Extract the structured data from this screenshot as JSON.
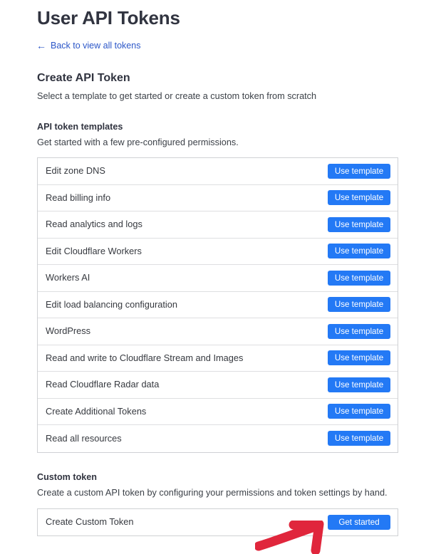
{
  "header": {
    "title": "User API Tokens",
    "back_link": {
      "label": "Back to view all tokens",
      "icon": "arrow-left-icon",
      "glyph": "←"
    }
  },
  "create_section": {
    "heading": "Create API Token",
    "description": "Select a template to get started or create a custom token from scratch"
  },
  "templates_section": {
    "heading": "API token templates",
    "description": "Get started with a few pre-configured permissions.",
    "button_label": "Use template",
    "items": [
      {
        "label": "Edit zone DNS"
      },
      {
        "label": "Read billing info"
      },
      {
        "label": "Read analytics and logs"
      },
      {
        "label": "Edit Cloudflare Workers"
      },
      {
        "label": "Workers AI"
      },
      {
        "label": "Edit load balancing configuration"
      },
      {
        "label": "WordPress"
      },
      {
        "label": "Read and write to Cloudflare Stream and Images"
      },
      {
        "label": "Read Cloudflare Radar data"
      },
      {
        "label": "Create Additional Tokens"
      },
      {
        "label": "Read all resources"
      }
    ]
  },
  "custom_section": {
    "heading": "Custom token",
    "description": "Create a custom API token by configuring your permissions and token settings by hand.",
    "row_label": "Create Custom Token",
    "button_label": "Get started"
  },
  "annotation": {
    "type": "arrow",
    "name": "red-arrow-annotation",
    "direction": "up-right",
    "points_to": "Get started",
    "color": "#e0263c"
  },
  "colors": {
    "accent_blue": "#2379f5",
    "link_blue": "#2c57c8",
    "heading": "#313440",
    "body_text": "#36393f",
    "border": "#cfd1d4",
    "row_divider": "#dedfe1",
    "annotation_red": "#e0263c",
    "background": "#ffffff"
  }
}
